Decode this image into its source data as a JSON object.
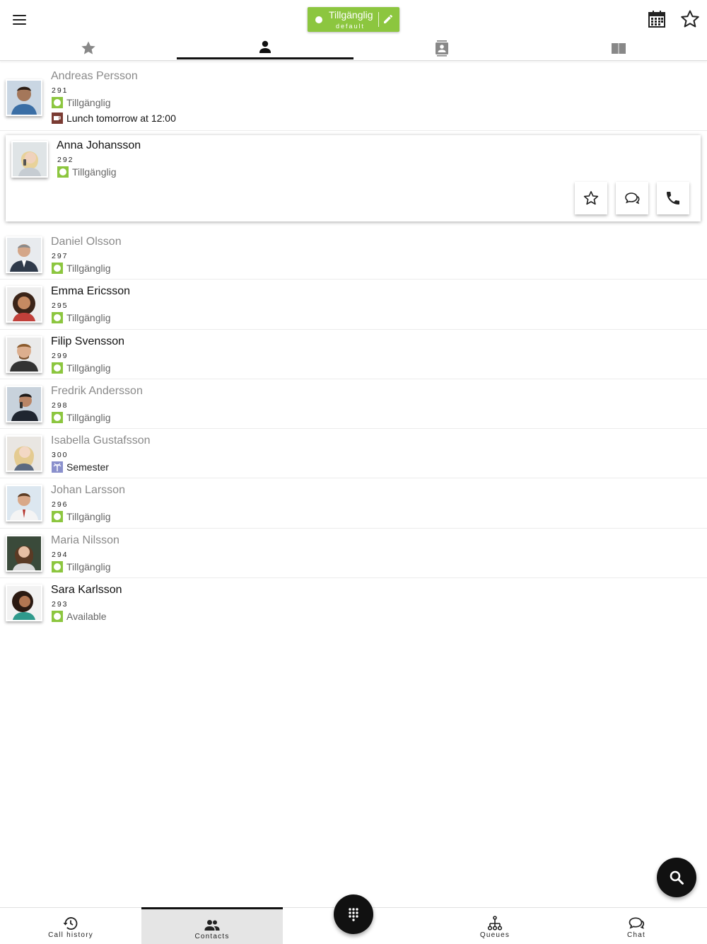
{
  "header": {
    "menu_icon": "hamburger-menu-icon",
    "status": {
      "label": "Tillgänglig",
      "profile": "default",
      "color": "#8cc63f"
    },
    "calendar_icon": "calendar-icon",
    "favorite_icon": "star-outline-icon"
  },
  "tabs": [
    {
      "icon": "star-icon",
      "active": false
    },
    {
      "icon": "person-icon",
      "active": true
    },
    {
      "icon": "contact-card-icon",
      "active": false
    },
    {
      "icon": "book-icon",
      "active": false
    }
  ],
  "contacts": [
    {
      "name": "Andreas Persson",
      "ext": "291",
      "status": "Tillgänglig",
      "status_type": "available",
      "extra_status": "Lunch tomorrow at 12:00",
      "extra_status_type": "lunch"
    },
    {
      "name": "Anna Johansson",
      "ext": "292",
      "status": "Tillgänglig",
      "status_type": "available",
      "expanded": true
    },
    {
      "name": "Daniel  Olsson",
      "ext": "297",
      "status": "Tillgänglig",
      "status_type": "available"
    },
    {
      "name": "Emma Ericsson",
      "ext": "295",
      "status": "Tillgänglig",
      "status_type": "available"
    },
    {
      "name": "Filip Svensson",
      "ext": "299",
      "status": "Tillgänglig",
      "status_type": "available"
    },
    {
      "name": "Fredrik Andersson",
      "ext": "298",
      "status": "Tillgänglig",
      "status_type": "available"
    },
    {
      "name": "Isabella Gustafsson",
      "ext": "300",
      "status": "Semester",
      "status_type": "vacation"
    },
    {
      "name": "Johan Larsson",
      "ext": "296",
      "status": "Tillgänglig",
      "status_type": "available"
    },
    {
      "name": "Maria Nilsson",
      "ext": "294",
      "status": "Tillgänglig",
      "status_type": "available"
    },
    {
      "name": "Sara  Karlsson",
      "ext": "293",
      "status": "Available",
      "status_type": "available"
    }
  ],
  "card_actions": [
    "star-outline-icon",
    "chat-icon",
    "phone-icon"
  ],
  "fab": {
    "search_icon": "search-icon",
    "dialpad_icon": "dialpad-icon"
  },
  "bottom_nav": [
    {
      "label": "Call history",
      "icon": "history-icon",
      "active": false
    },
    {
      "label": "Contacts",
      "icon": "contacts-icon",
      "active": true
    },
    {
      "label": "",
      "icon": "dialpad-icon",
      "active": false
    },
    {
      "label": "Queues",
      "icon": "queues-icon",
      "active": false
    },
    {
      "label": "Chat",
      "icon": "chat-icon",
      "active": false
    }
  ],
  "colors": {
    "available": "#8cc63f",
    "lunch": "#7a3b33",
    "vacation": "#8a90cc",
    "accent": "#111111"
  }
}
